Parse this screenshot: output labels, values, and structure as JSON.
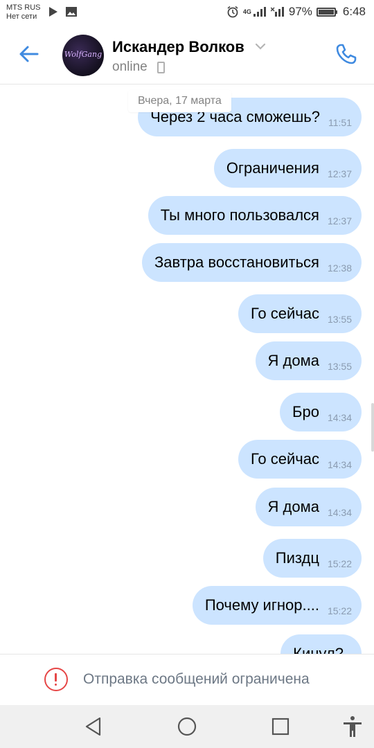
{
  "status_bar": {
    "carrier": "MTS RUS",
    "network": "Нет сети",
    "signal_label": "4G",
    "battery": "97%",
    "time": "6:48"
  },
  "header": {
    "avatar_text": "WolfGang",
    "name": "Искандер Волков",
    "status": "online"
  },
  "date_chip": "Вчера, 17 марта",
  "messages": [
    {
      "text": "Через 2 часа сможешь?",
      "time": "11:51"
    },
    {
      "text": "Ограничения",
      "time": "12:37"
    },
    {
      "text": "Ты много пользовался",
      "time": "12:37"
    },
    {
      "text": "Завтра восстановиться",
      "time": "12:38"
    },
    {
      "text": "Го сейчас",
      "time": "13:55"
    },
    {
      "text": "Я дома",
      "time": "13:55"
    },
    {
      "text": "Бро",
      "time": "14:34"
    },
    {
      "text": "Го сейчас",
      "time": "14:34"
    },
    {
      "text": "Я дома",
      "time": "14:34"
    },
    {
      "text": "Пиздц",
      "time": "15:22"
    },
    {
      "text": "Почему игнор....",
      "time": "15:22"
    },
    {
      "text": "Кинул?",
      "time": ""
    }
  ],
  "restriction": {
    "text": "Отправка сообщений ограничена"
  },
  "colors": {
    "accent": "#3f8ae0",
    "bubble": "#cce4ff",
    "warning": "#e64646"
  }
}
